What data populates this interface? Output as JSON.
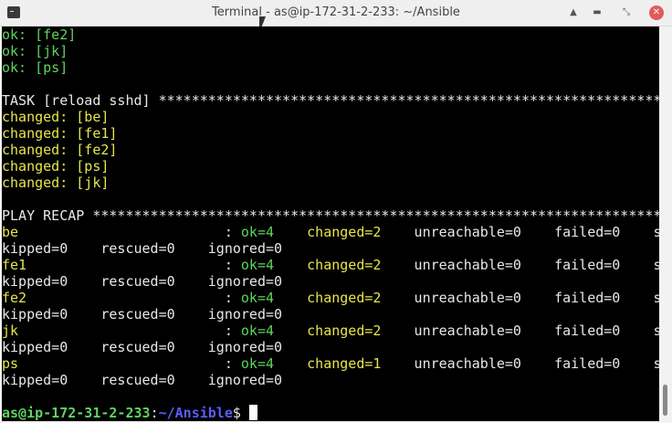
{
  "window": {
    "title": "Terminal - as@ip-172-31-2-233: ~/Ansible",
    "icons": [
      "terminal-icon",
      "shade-icon",
      "minimize-icon",
      "maximize-icon",
      "close-icon"
    ]
  },
  "colors": {
    "green": "#5fd35f",
    "yellow": "#e6e64a",
    "white": "#e8e8e8",
    "blue": "#5c5cff"
  },
  "lines": [
    [
      {
        "t": "ok: [fe2]",
        "c": "green"
      }
    ],
    [
      {
        "t": "ok: [jk]",
        "c": "green"
      }
    ],
    [
      {
        "t": "ok: [ps]",
        "c": "green"
      }
    ],
    [],
    [
      {
        "t": "TASK [reload sshd] *************************************************************",
        "c": "white"
      }
    ],
    [
      {
        "t": "changed: [be]",
        "c": "yellow"
      }
    ],
    [
      {
        "t": "changed: [fe1]",
        "c": "yellow"
      }
    ],
    [
      {
        "t": "changed: [fe2]",
        "c": "yellow"
      }
    ],
    [
      {
        "t": "changed: [ps]",
        "c": "yellow"
      }
    ],
    [
      {
        "t": "changed: [jk]",
        "c": "yellow"
      }
    ],
    [],
    [
      {
        "t": "PLAY RECAP *********************************************************************",
        "c": "white"
      }
    ],
    [
      {
        "t": "be",
        "c": "yellow"
      },
      {
        "t": "                         : ",
        "c": "white"
      },
      {
        "t": "ok=4",
        "c": "green"
      },
      {
        "t": "    ",
        "c": "white"
      },
      {
        "t": "changed=2",
        "c": "yellow"
      },
      {
        "t": "    unreachable=0    failed=0    s",
        "c": "white"
      }
    ],
    [
      {
        "t": "kipped=0    rescued=0    ignored=0",
        "c": "white"
      }
    ],
    [
      {
        "t": "fe1",
        "c": "yellow"
      },
      {
        "t": "                        : ",
        "c": "white"
      },
      {
        "t": "ok=4",
        "c": "green"
      },
      {
        "t": "    ",
        "c": "white"
      },
      {
        "t": "changed=2",
        "c": "yellow"
      },
      {
        "t": "    unreachable=0    failed=0    s",
        "c": "white"
      }
    ],
    [
      {
        "t": "kipped=0    rescued=0    ignored=0",
        "c": "white"
      }
    ],
    [
      {
        "t": "fe2",
        "c": "yellow"
      },
      {
        "t": "                        : ",
        "c": "white"
      },
      {
        "t": "ok=4",
        "c": "green"
      },
      {
        "t": "    ",
        "c": "white"
      },
      {
        "t": "changed=2",
        "c": "yellow"
      },
      {
        "t": "    unreachable=0    failed=0    s",
        "c": "white"
      }
    ],
    [
      {
        "t": "kipped=0    rescued=0    ignored=0",
        "c": "white"
      }
    ],
    [
      {
        "t": "jk",
        "c": "yellow"
      },
      {
        "t": "                         : ",
        "c": "white"
      },
      {
        "t": "ok=4",
        "c": "green"
      },
      {
        "t": "    ",
        "c": "white"
      },
      {
        "t": "changed=2",
        "c": "yellow"
      },
      {
        "t": "    unreachable=0    failed=0    s",
        "c": "white"
      }
    ],
    [
      {
        "t": "kipped=0    rescued=0    ignored=0",
        "c": "white"
      }
    ],
    [
      {
        "t": "ps",
        "c": "yellow"
      },
      {
        "t": "                         : ",
        "c": "white"
      },
      {
        "t": "ok=4",
        "c": "green"
      },
      {
        "t": "    ",
        "c": "white"
      },
      {
        "t": "changed=1",
        "c": "yellow"
      },
      {
        "t": "    unreachable=0    failed=0    s",
        "c": "white"
      }
    ],
    [
      {
        "t": "kipped=0    rescued=0    ignored=0",
        "c": "white"
      }
    ],
    []
  ],
  "prompt": {
    "user_host": "as@ip-172-31-2-233",
    "sep": ":",
    "path": "~/Ansible",
    "symbol": "$ "
  }
}
